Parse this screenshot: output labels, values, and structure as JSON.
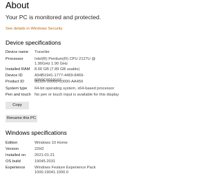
{
  "header": {
    "title": "About",
    "protection_text": "Your PC is monitored and protected.",
    "security_link": "See details in Windows Security"
  },
  "device": {
    "section_title": "Device specifications",
    "specs": [
      {
        "label": "Device name",
        "value": "Traveller"
      },
      {
        "label": "Processor",
        "value": "Intel(R) Pentium(R) CPU 2127U @ 1.90GHz   1.90 GHz"
      },
      {
        "label": "Installed RAM",
        "value": "8.00 GB (7.89 GB usable)"
      },
      {
        "label": "Device ID",
        "value": "A94B1941-1777-4469-8469-6050C6019197"
      },
      {
        "label": "Product ID",
        "value": "00326-10000-00000-AA459"
      },
      {
        "label": "System type",
        "value": "64-bit operating system, x64-based processor"
      },
      {
        "label": "Pen and touch",
        "value": "No pen or touch input is available for this display"
      }
    ],
    "copy_label": "Copy",
    "rename_label": "Rename this PC"
  },
  "windows": {
    "section_title": "Windows specifications",
    "specs": [
      {
        "label": "Edition",
        "value": "Windows 10 Home"
      },
      {
        "label": "Version",
        "value": "22H2"
      },
      {
        "label": "Installed on",
        "value": "2021-01-21"
      },
      {
        "label": "OS build",
        "value": "19045.2031"
      },
      {
        "label": "Experience",
        "value": "Windows Feature Experience Pack 1000.19041.1000.0"
      }
    ]
  }
}
